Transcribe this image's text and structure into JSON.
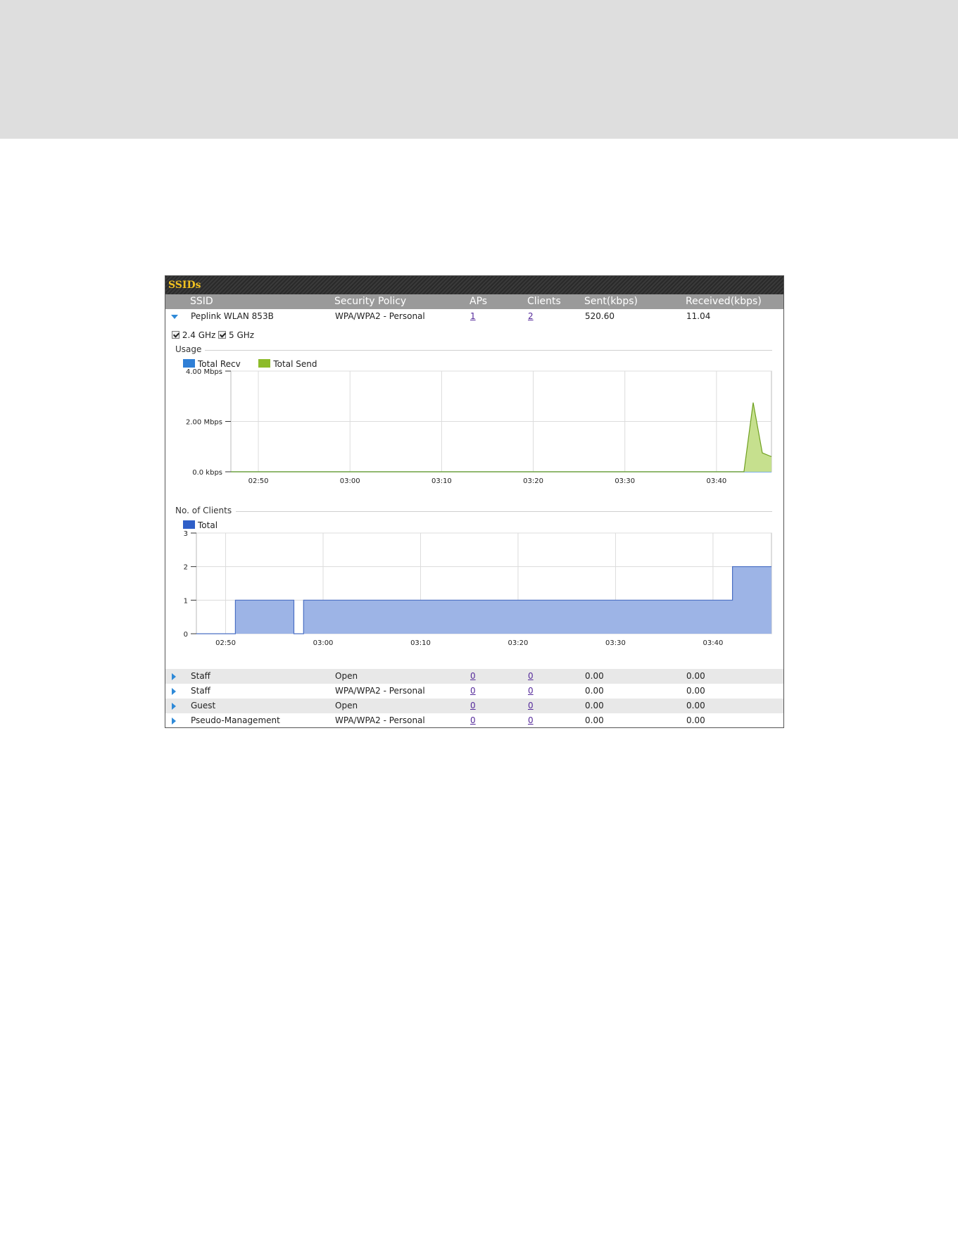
{
  "panel": {
    "title": "SSIDs"
  },
  "columns": [
    "SSID",
    "Security Policy",
    "APs",
    "Clients",
    "Sent(kbps)",
    "Received(kbps)"
  ],
  "expanded_row": {
    "ssid": "Peplink WLAN 853B",
    "security": "WPA/WPA2 - Personal",
    "aps": "1",
    "clients": "2",
    "sent": "520.60",
    "received": "11.04"
  },
  "freq": {
    "band1": "2.4 GHz",
    "band2": "5 GHz"
  },
  "usage": {
    "label": "Usage",
    "legend": [
      {
        "name": "Total Recv",
        "color": "#2f7fd6"
      },
      {
        "name": "Total Send",
        "color": "#8dbb2a"
      }
    ],
    "y_ticks": [
      "4.00 Mbps",
      "2.00 Mbps",
      "0.0 kbps"
    ],
    "x_ticks": [
      "02:50",
      "03:00",
      "03:10",
      "03:20",
      "03:30",
      "03:40"
    ]
  },
  "clients_chart": {
    "label": "No. of Clients",
    "legend": [
      {
        "name": "Total",
        "color": "#2f5fc8"
      }
    ],
    "y_ticks": [
      "3",
      "2",
      "1",
      "0"
    ],
    "x_ticks": [
      "02:50",
      "03:00",
      "03:10",
      "03:20",
      "03:30",
      "03:40"
    ]
  },
  "chart_data": [
    {
      "type": "area",
      "ylabel": "",
      "ylim": [
        0,
        4
      ],
      "xlim": [
        "02:47",
        "03:46"
      ],
      "series": [
        {
          "name": "Total Recv",
          "x": [
            "02:47",
            "03:46"
          ],
          "values": [
            0,
            0
          ]
        },
        {
          "name": "Total Send",
          "x": [
            "02:47",
            "03:43",
            "03:44",
            "03:45",
            "03:46"
          ],
          "values": [
            0,
            0,
            2.75,
            0.75,
            0.6
          ]
        }
      ],
      "grid": true
    },
    {
      "type": "area",
      "ylabel": "",
      "ylim": [
        0,
        3
      ],
      "xlim": [
        "02:47",
        "03:46"
      ],
      "series": [
        {
          "name": "Total",
          "x": [
            "02:47",
            "02:51",
            "02:57",
            "02:58",
            "03:42",
            "03:46"
          ],
          "values": [
            0,
            1,
            0,
            1,
            2,
            2
          ]
        }
      ],
      "grid": true
    }
  ],
  "other_rows": [
    {
      "ssid": "Staff",
      "security": "Open",
      "aps": "0",
      "clients": "0",
      "sent": "0.00",
      "received": "0.00"
    },
    {
      "ssid": "Staff",
      "security": "WPA/WPA2 - Personal",
      "aps": "0",
      "clients": "0",
      "sent": "0.00",
      "received": "0.00"
    },
    {
      "ssid": "Guest",
      "security": "Open",
      "aps": "0",
      "clients": "0",
      "sent": "0.00",
      "received": "0.00"
    },
    {
      "ssid": "Pseudo-Management",
      "security": "WPA/WPA2 - Personal",
      "aps": "0",
      "clients": "0",
      "sent": "0.00",
      "received": "0.00"
    }
  ]
}
